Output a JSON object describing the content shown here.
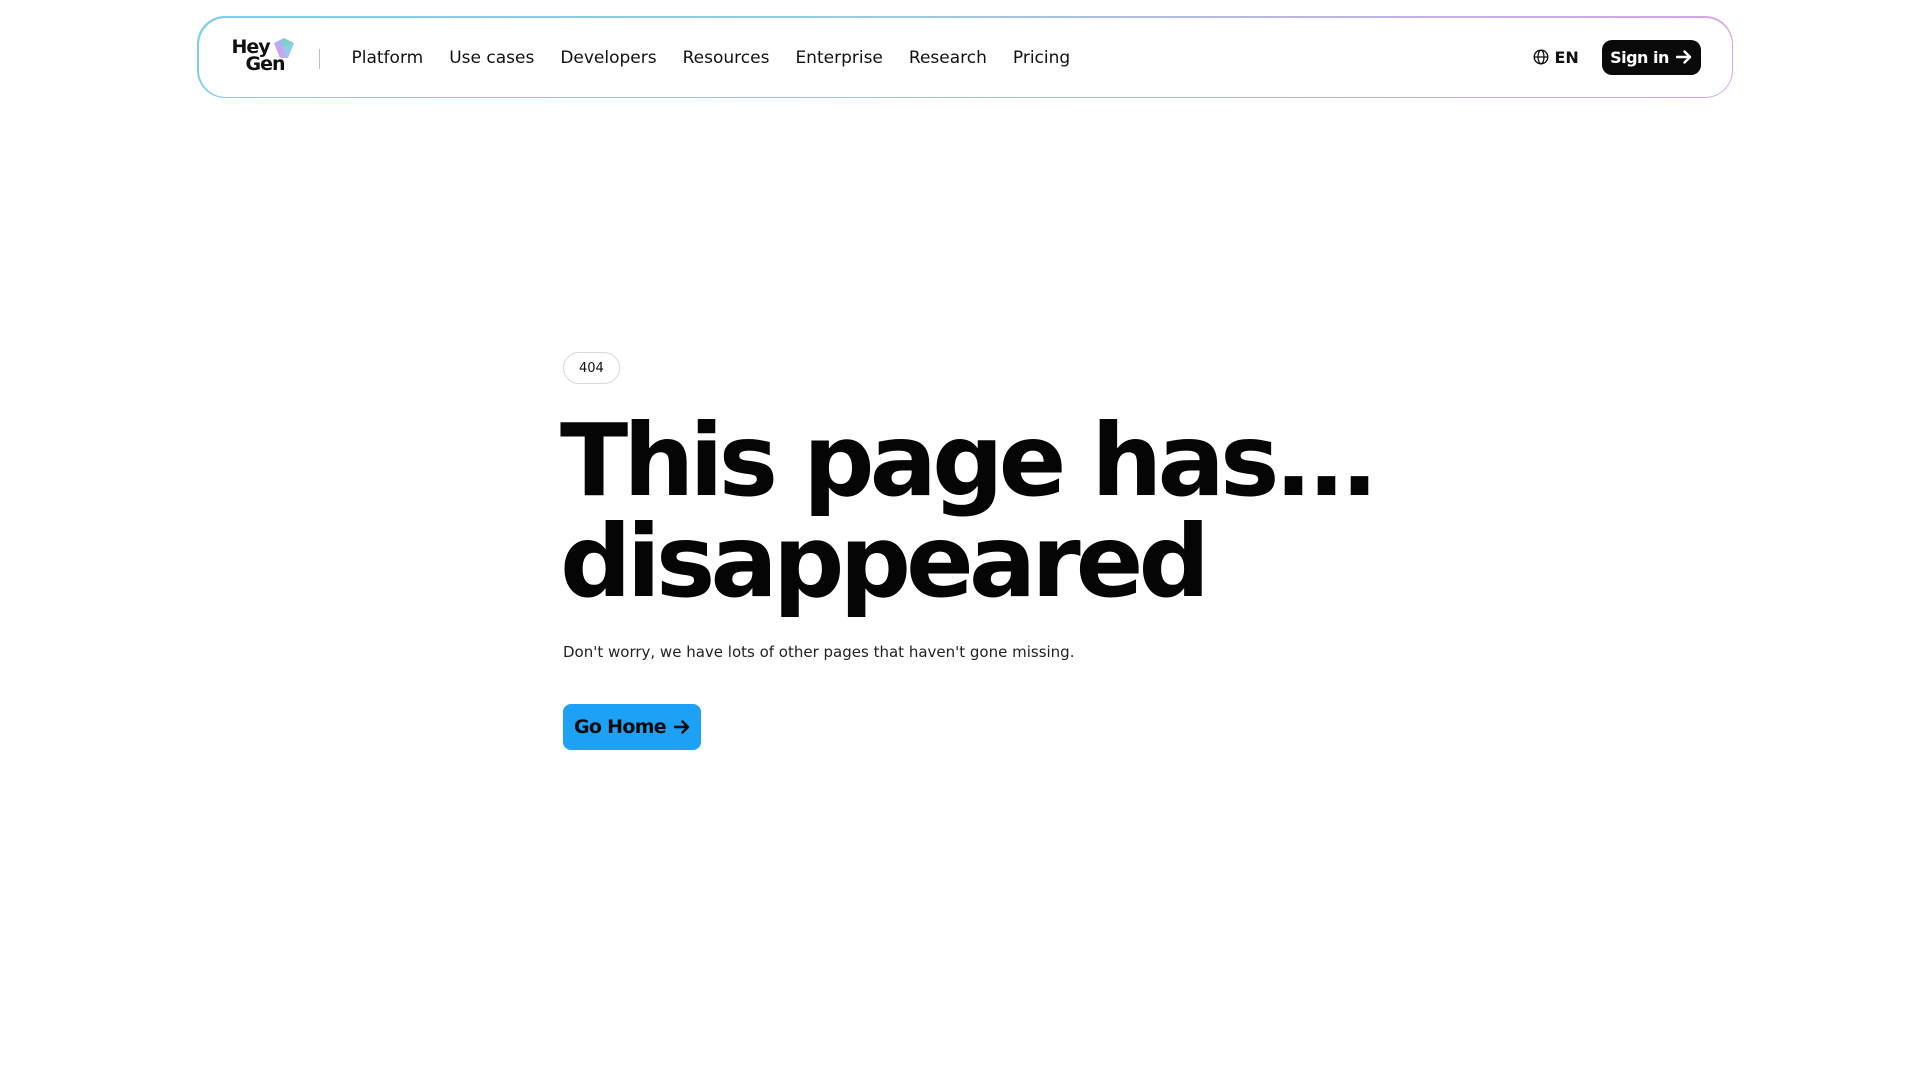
{
  "header": {
    "logo": {
      "line1": "Hey",
      "line2": "Gen"
    },
    "nav": [
      {
        "label": "Platform"
      },
      {
        "label": "Use cases"
      },
      {
        "label": "Developers"
      },
      {
        "label": "Resources"
      },
      {
        "label": "Enterprise"
      },
      {
        "label": "Research"
      },
      {
        "label": "Pricing"
      }
    ],
    "language": {
      "label": "EN",
      "icon": "globe-icon"
    },
    "signin": {
      "label": "Sign in",
      "icon": "arrow-right-icon"
    }
  },
  "main": {
    "badge": "404",
    "headline_line1": "This page has...",
    "headline_line2": "disappeared",
    "subtitle": "Don't worry, we have lots of other pages that haven't gone missing.",
    "cta": {
      "label": "Go Home",
      "icon": "arrow-right-icon"
    }
  },
  "colors": {
    "cta_background": "#1da1f5",
    "signin_background": "#0a0a0a",
    "header_border_start": "#7fcfe6",
    "header_border_end": "#d8a6e6"
  }
}
